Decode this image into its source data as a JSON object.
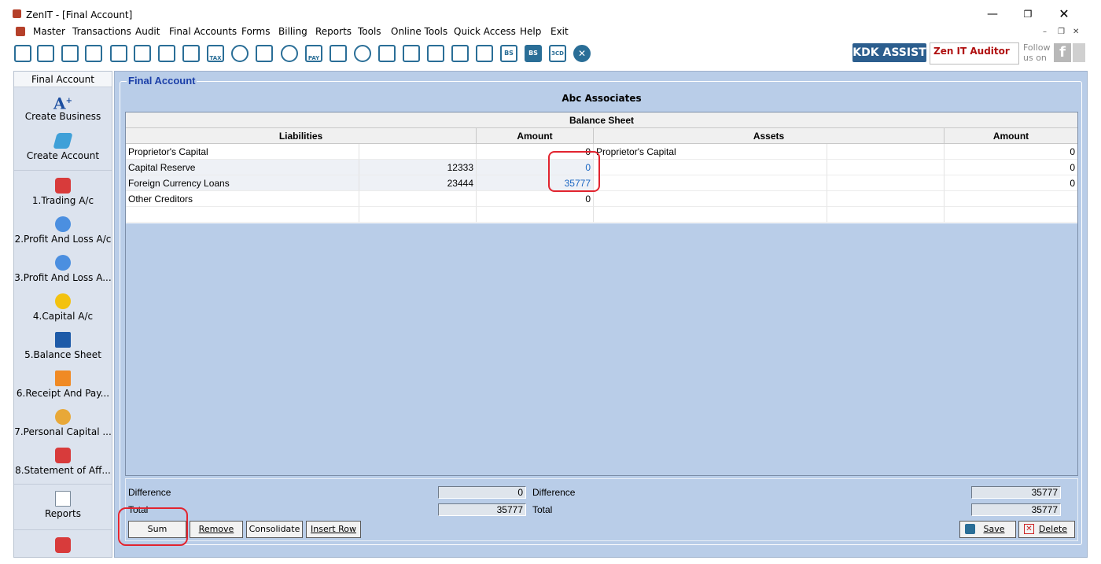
{
  "window": {
    "title": "ZenIT - [Final Account]"
  },
  "menu": [
    "Master",
    "Transactions",
    "Audit",
    "Final Accounts",
    "Forms",
    "Billing",
    "Reports",
    "Tools",
    "Online Tools",
    "Quick Access",
    "Help",
    "Exit"
  ],
  "toolbar": {
    "icons": [
      "ledger-icon",
      "home-icon",
      "building-icon",
      "bar-chart-icon",
      "gift-icon",
      "people-icon",
      "pin-icon",
      "filter-icon",
      "tax-icon",
      "eye-icon",
      "calculator-icon",
      "pie-icon",
      "pay-icon",
      "book-icon",
      "info-icon",
      "document-icon",
      "person-doc-icon",
      "calendar-icon",
      "gear-doc-icon",
      "copy-icon",
      "bs-icon",
      "bs-sch-icon",
      "3cd-icon",
      "close-circle-icon"
    ],
    "tax_label": "TAX",
    "pay_label": "PAY",
    "bs_label": "BS",
    "sch_label": "BS",
    "cd_label": "3CD",
    "kdk_label": "KDK ASSIST",
    "auditor_label": "Zen IT Auditor",
    "follow_label": "Follow us on",
    "fb_label": "f"
  },
  "sidebar": {
    "header": "Final Account",
    "items": [
      {
        "label": "Create Business",
        "icon": "a-plus-icon"
      },
      {
        "label": "Create Account",
        "icon": "add-account-icon"
      },
      {
        "label": "1.Trading A/c",
        "icon": "globe-book-icon"
      },
      {
        "label": "2.Profit And Loss A/c",
        "icon": "globe-hand-icon"
      },
      {
        "label": "3.Profit And Loss A...",
        "icon": "globe-hand-icon"
      },
      {
        "label": "4.Capital A/c",
        "icon": "money-bag-icon"
      },
      {
        "label": "5.Balance Sheet",
        "icon": "bs-doc-icon"
      },
      {
        "label": "6.Receipt And Pay...",
        "icon": "shop-icon"
      },
      {
        "label": "7.Personal Capital ...",
        "icon": "person-icon"
      },
      {
        "label": "8.Statement of Aff...",
        "icon": "globe-book-icon"
      }
    ],
    "reports_label": "Reports"
  },
  "main": {
    "group_title": "Final Account",
    "company": "Abc Associates",
    "grid_caption": "Balance Sheet",
    "headers": {
      "liabilities": "Liabilities",
      "amount_left": "Amount",
      "assets": "Assets",
      "amount_right": "Amount"
    },
    "rows": [
      {
        "liability": "Proprietor's Capital",
        "sub": "",
        "amount": "0",
        "asset": "Proprietor's Capital",
        "asset_sub": "",
        "asset_amount": "0"
      },
      {
        "liability": "Capital Reserve",
        "sub": "12333",
        "amount": "0",
        "asset": "",
        "asset_sub": "",
        "asset_amount": "0"
      },
      {
        "liability": "Foreign Currency Loans",
        "sub": "23444",
        "amount": "35777",
        "asset": "",
        "asset_sub": "",
        "asset_amount": "0"
      },
      {
        "liability": "Other Creditors",
        "sub": "",
        "amount": "0",
        "asset": "",
        "asset_sub": "",
        "asset_amount": ""
      }
    ]
  },
  "footer": {
    "difference_label": "Difference",
    "total_label": "Total",
    "left_difference": "0",
    "left_total": "35777",
    "right_difference": "35777",
    "right_total": "35777"
  },
  "buttons": {
    "sum": "Sum",
    "remove": "Remove",
    "consolidate": "Consolidate",
    "insert_row": "Insert Row",
    "save": "Save",
    "delete": "Delete"
  }
}
